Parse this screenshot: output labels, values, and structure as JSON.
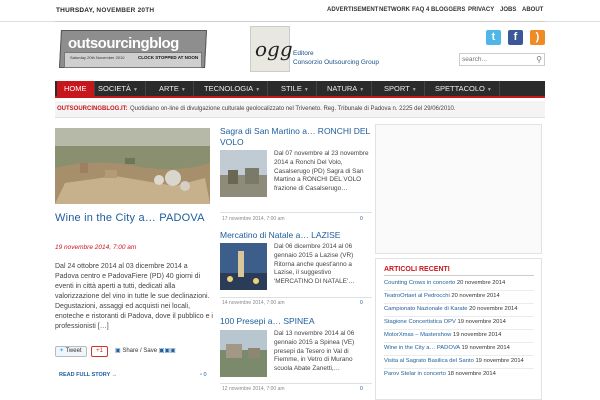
{
  "topbar": {
    "day": "THURSDAY,",
    "date": "NOVEMBER 20TH",
    "links": [
      "ADVERTISEMENT",
      "NETWORK",
      "FAQ 4 BLOGGERS",
      "PRIVACY",
      "JOBS",
      "ABOUT"
    ]
  },
  "header": {
    "logo_word": "outsourcing",
    "logo_word2": "blog",
    "logo_sub": "Saturday 20th November 2010",
    "logo_stamp": "CLOCK STOPPED AT NOON",
    "editor_mark": "ogg",
    "editor_label": "Editore",
    "editor_name": "Consorzio Outsourcing Group",
    "search_placeholder": "search...",
    "social": [
      "twitter-icon",
      "facebook-icon",
      "rss-icon"
    ],
    "social_glyphs": [
      "t",
      "f",
      ")"
    ]
  },
  "nav": {
    "items": [
      "HOME",
      "SOCIETÀ",
      "ARTE",
      "TECNOLOGIA",
      "STILE",
      "NATURA",
      "SPORT",
      "SPETTACOLO"
    ],
    "active": "HOME",
    "active_color": "#c8161d"
  },
  "ticker": {
    "label": "OUTSOURCINGBLOG.IT:",
    "text": "Quotidiano on-line di divulgazione culturale geolocalizzato nel Triveneto. Reg. Tribunale di Padova n. 2225 del 29/06/2010."
  },
  "feature": {
    "title": "Wine in the City a… PADOVA",
    "date": "19 novembre 2014, 7:00 am",
    "body": "Dal 24 ottobre 2014 al 03 dicembre 2014 a Padova centro e PadovaFiere (PD) 40 giorni di eventi in città aperti a tutti, dedicati alla valorizzazione del vino in tutte le sue declinazioni. Degustazioni, assaggi ed acquisti nei locali, enoteche e ristoranti di Padova, dove il pubblico e i professionisti […]",
    "tweet_label": "Tweet",
    "plus_label": "+1",
    "share_label": "Share / Save",
    "read_more": "READ FULL STORY →",
    "comments": "0"
  },
  "articles": [
    {
      "title": "Sagra di San Martino a… RONCHI DEL VOLO",
      "body": "Dal 07 novembre al 23 novembre 2014 a Ronchi Del Volo, Casalserugo (PD) Sagra di San Martino a RONCHI DEL VOLO frazione di Casalserugo…",
      "meta": "17 novembre 2014, 7:00 am",
      "comments": "0"
    },
    {
      "title": "Mercatino di Natale a… LAZISE",
      "body": "Dal 06 dicembre 2014 al 06 gennaio 2015 a Lazise (VR) Ritorna anche quest'anno a Lazise, il suggestivo 'MERCATINO DI NATALE'…",
      "meta": "14 novembre 2014, 7:00 am",
      "comments": "0"
    },
    {
      "title": "100 Presepi a… SPINEA",
      "body": "Dal 13 novembre 2014 al 06 gennaio 2015 a Spinea (VE) presepi da Tesero in Val di Fiemme, in Vetro di Murano scuola Abate Zanetti,…",
      "meta": "12 novembre 2014, 7:00 am",
      "comments": "0"
    }
  ],
  "sidebar": {
    "recent_title": "ARTICOLI RECENTI",
    "recent": [
      {
        "link": "Counting Crows in concerto",
        "date": "20 novembre 2014"
      },
      {
        "link": "TeatroOrtaet al Pedrocchi",
        "date": "20 novembre 2014"
      },
      {
        "link": "Campionato Nazionale di Karate",
        "date": "20 novembre 2014"
      },
      {
        "link": "Stagione Concertistica OPV",
        "date": "19 novembre 2014"
      },
      {
        "link": "MotorXmas – Mastershow",
        "date": "19 novembre 2014"
      },
      {
        "link": "Wine in the City a… PADOVA",
        "date": "19 novembre 2014"
      },
      {
        "link": "Visita al Sagrato Basilica del Santo",
        "date": "19 novembre 2014"
      },
      {
        "link": "Parov Stelar in concerto",
        "date": "18 novembre 2014"
      }
    ]
  }
}
